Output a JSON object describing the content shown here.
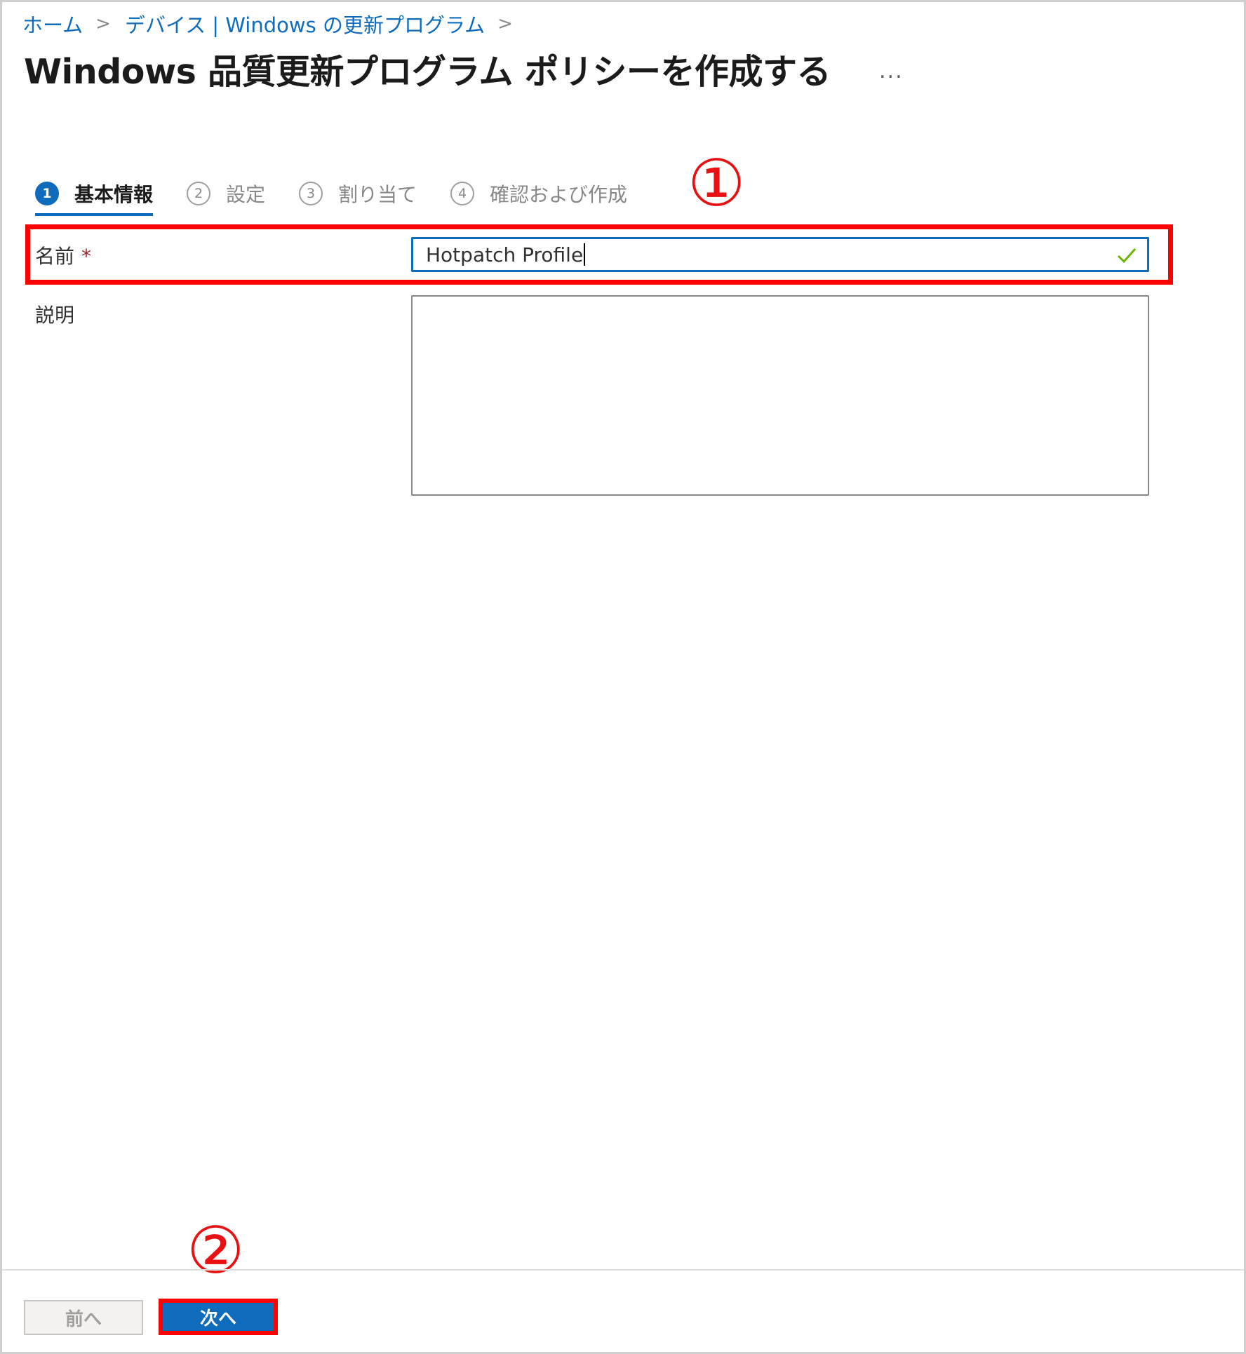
{
  "breadcrumb": {
    "items": [
      "ホーム",
      "デバイス | Windows の更新プログラム"
    ],
    "separator": ">"
  },
  "page": {
    "title": "Windows 品質更新プログラム ポリシーを作成する",
    "more": "..."
  },
  "steps": [
    {
      "num": "1",
      "label": "基本情報",
      "active": true
    },
    {
      "num": "2",
      "label": "設定",
      "active": false
    },
    {
      "num": "3",
      "label": "割り当て",
      "active": false
    },
    {
      "num": "4",
      "label": "確認および作成",
      "active": false
    }
  ],
  "form": {
    "name_label": "名前",
    "required_mark": "*",
    "name_value": "Hotpatch Profile",
    "description_label": "説明",
    "description_value": ""
  },
  "annotations": {
    "one": "①",
    "two": "②"
  },
  "footer": {
    "prev_label": "前へ",
    "next_label": "次へ"
  },
  "colors": {
    "accent": "#0f6cbd",
    "highlight": "#ff0000",
    "valid_check": "#6bb700"
  }
}
